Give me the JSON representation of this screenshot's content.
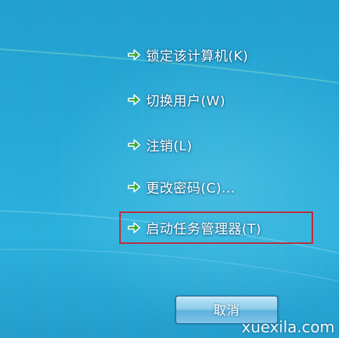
{
  "menu": {
    "items": [
      {
        "label": "锁定该计算机(K)"
      },
      {
        "label": "切换用户(W)"
      },
      {
        "label": "注销(L)"
      },
      {
        "label": "更改密码(C)..."
      },
      {
        "label": "启动任务管理器(T)",
        "highlighted": true
      }
    ]
  },
  "cancel_button": {
    "label": "取消"
  },
  "watermark": {
    "text": "xuexila.com"
  },
  "colors": {
    "background": "#21a9d8",
    "arrow_green": "#3aa83a",
    "highlight_border": "#c8232c",
    "text": "#ffffff"
  },
  "icons": {
    "menu_item_icon": "green-arrow-icon"
  }
}
